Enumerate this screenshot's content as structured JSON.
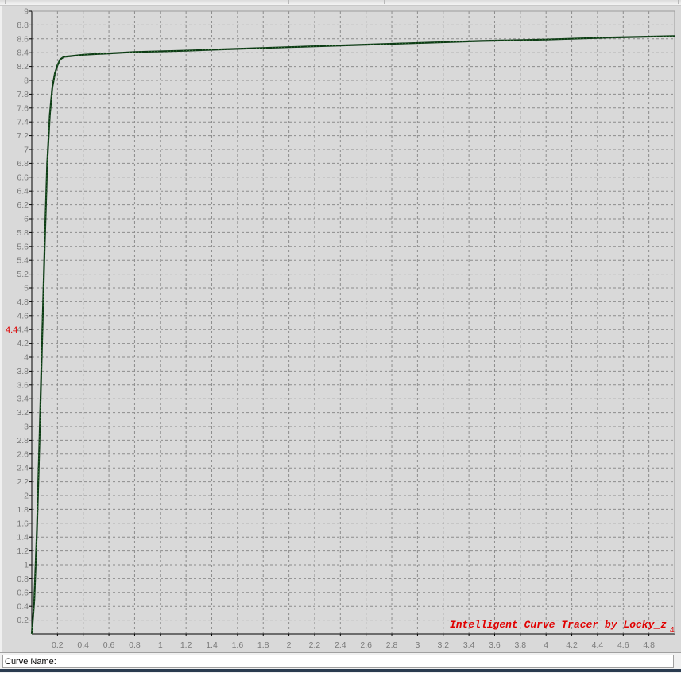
{
  "status_bar": {
    "curve_name_label": "Curve Name:",
    "curve_name_value": ""
  },
  "watermark": "Intelligent Curve Tracer by Locky_z",
  "cursor_readout": {
    "y": "4.4",
    "x": "4."
  },
  "colors": {
    "plot_background": "#d9d9d9",
    "grid": "#8c8c8c",
    "curve": "#0c3a14",
    "axis": "#000000",
    "tick_label": "#7a7a7a",
    "accent_red": "#e00000"
  },
  "chart_data": {
    "type": "line",
    "title": "",
    "xlabel": "",
    "ylabel": "",
    "xlim": [
      0,
      5
    ],
    "ylim": [
      0,
      9
    ],
    "grid": true,
    "x_ticks": [
      "0.2",
      "0.4",
      "0.6",
      "0.8",
      "1",
      "1.2",
      "1.4",
      "1.6",
      "1.8",
      "2",
      "2.2",
      "2.4",
      "2.6",
      "2.8",
      "3",
      "3.2",
      "3.4",
      "3.6",
      "3.8",
      "4",
      "4.2",
      "4.4",
      "4.6",
      "4.8"
    ],
    "y_ticks": [
      "0.2",
      "0.4",
      "0.6",
      "0.8",
      "1",
      "1.2",
      "1.4",
      "1.6",
      "1.8",
      "2",
      "2.2",
      "2.4",
      "2.6",
      "2.8",
      "3",
      "3.2",
      "3.4",
      "3.6",
      "3.8",
      "4",
      "4.2",
      "4.4",
      "4.6",
      "4.8",
      "5",
      "5.2",
      "5.4",
      "5.6",
      "5.8",
      "6",
      "6.2",
      "6.4",
      "6.6",
      "6.8",
      "7",
      "7.2",
      "7.4",
      "7.6",
      "7.8",
      "8",
      "8.2",
      "8.4",
      "8.6",
      "8.8",
      "9"
    ],
    "series": [
      {
        "x": [
          0.0,
          0.02,
          0.04,
          0.06,
          0.08,
          0.1,
          0.12,
          0.14,
          0.16,
          0.18,
          0.2,
          0.22,
          0.25,
          0.3,
          0.35,
          0.4,
          0.5,
          0.6,
          0.8,
          1.0,
          1.2,
          1.5,
          2.0,
          2.5,
          3.0,
          3.5,
          4.0,
          4.5,
          5.0
        ],
        "y": [
          0.0,
          0.5,
          1.5,
          2.8,
          4.2,
          5.6,
          6.8,
          7.5,
          7.9,
          8.1,
          8.22,
          8.3,
          8.34,
          8.35,
          8.36,
          8.37,
          8.38,
          8.39,
          8.41,
          8.42,
          8.43,
          8.45,
          8.48,
          8.51,
          8.54,
          8.57,
          8.59,
          8.62,
          8.64
        ]
      }
    ]
  }
}
